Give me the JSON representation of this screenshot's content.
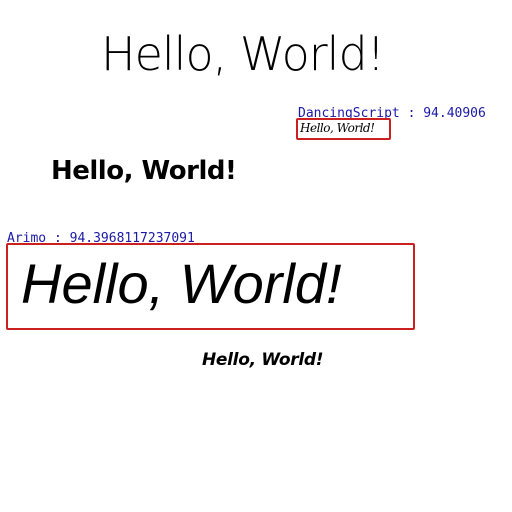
{
  "texts": {
    "hello_light": "Hello, World!",
    "hello_bold": "Hello, World!",
    "hello_script": "Hello, World!",
    "hello_italic_large": "Hello, World!",
    "hello_italic_small": "Hello, World!"
  },
  "annotations": {
    "dancing": {
      "label": "DancingScript :  94.40906",
      "color": "#1a1aa6",
      "box_color": "#cc1f1f"
    },
    "arimo": {
      "label": "Arimo :  94.3968117237091",
      "color": "#1a1aa6",
      "box_color": "#cc1f1f"
    }
  }
}
